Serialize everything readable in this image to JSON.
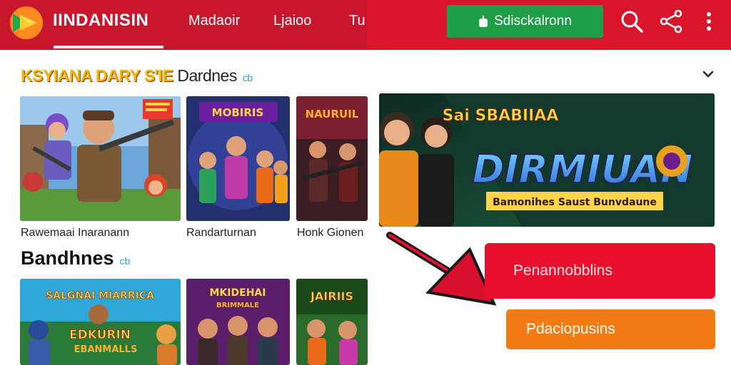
{
  "header": {
    "brand": "IINDANISIN",
    "nav": [
      "Madaoir",
      "Ljaioo",
      "Tu"
    ],
    "download_button": "Sdisckalronn"
  },
  "section1": {
    "title": "KSYIANA DARY S'IE",
    "title_suffix": "Dardnes",
    "tag": "cb",
    "cards": [
      {
        "caption": "Rawemaai Inaranann",
        "art_text": ""
      },
      {
        "caption": "Randarturnan",
        "art_text": "MOBIRIS"
      },
      {
        "caption": "Honk Gionen",
        "art_text": "NAURUIL"
      }
    ]
  },
  "section2": {
    "title": "Bandhnes",
    "tag": "cb",
    "cards": [
      {
        "art_text": "SALGNAI MIARRICA",
        "art_text2": "EDKURIN",
        "art_text3": "EBANMALLS"
      },
      {
        "art_text": "MKIDEHAI",
        "art_text2": "BRIMMALE"
      },
      {
        "art_text": "JAIRIIS"
      }
    ]
  },
  "banner": {
    "top_text": "Sai SBABIIAA",
    "main_text": "DIRMIUAN",
    "sub_text": "Bamonihes Saust Bunvdaune"
  },
  "actions": {
    "primary": "Penannobblins",
    "secondary": "Pdaciopusins"
  },
  "colors": {
    "header": "#c8162c",
    "download": "#1e9e47",
    "primary": "#e8102d",
    "secondary": "#f47a14",
    "title_gold": "#f2b705"
  }
}
